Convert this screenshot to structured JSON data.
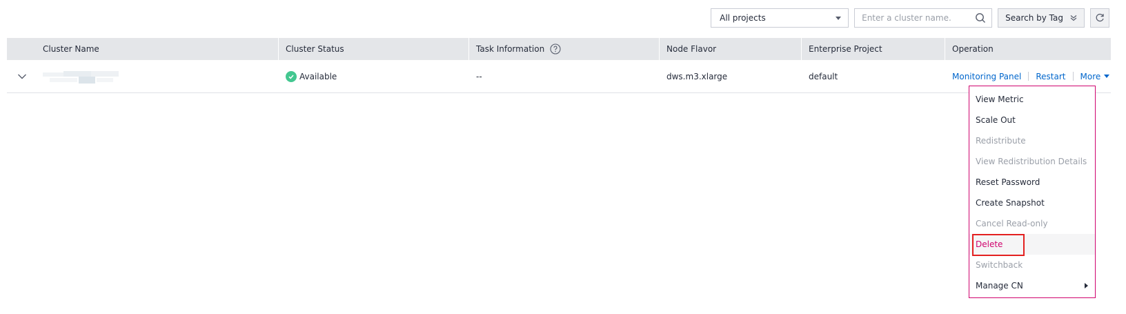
{
  "toolbar": {
    "project_select_value": "All projects",
    "search_placeholder": "Enter a cluster name.",
    "tag_search_label": "Search by Tag"
  },
  "table": {
    "columns": [
      "Cluster Name",
      "Cluster Status",
      "Task Information",
      "Node Flavor",
      "Enterprise Project",
      "Operation"
    ],
    "rows": [
      {
        "status": "Available",
        "task_info": "--",
        "node_flavor": "dws.m3.xlarge",
        "enterprise_project": "default",
        "operations": [
          "Monitoring Panel",
          "Restart",
          "More"
        ]
      }
    ]
  },
  "more_menu": {
    "items": [
      {
        "label": "View Metric",
        "enabled": true
      },
      {
        "label": "Scale Out",
        "enabled": true
      },
      {
        "label": "Redistribute",
        "enabled": false
      },
      {
        "label": "View Redistribution Details",
        "enabled": false
      },
      {
        "label": "Reset Password",
        "enabled": true
      },
      {
        "label": "Create Snapshot",
        "enabled": true
      },
      {
        "label": "Cancel Read-only",
        "enabled": false
      },
      {
        "label": "Delete",
        "enabled": true,
        "highlighted": true
      },
      {
        "label": "Switchback",
        "enabled": false
      },
      {
        "label": "Manage CN",
        "enabled": true,
        "has_submenu": true
      }
    ]
  },
  "colors": {
    "link": "#0066cc",
    "status_ok": "#43c790",
    "danger": "#d0036e",
    "highlight_box": "#e32020",
    "header_bg": "#e4e6e9"
  },
  "icons": [
    "chevron-down-icon",
    "search-icon",
    "refresh-icon",
    "help-icon",
    "check-circle-icon",
    "caret-down-icon",
    "caret-right-icon"
  ]
}
